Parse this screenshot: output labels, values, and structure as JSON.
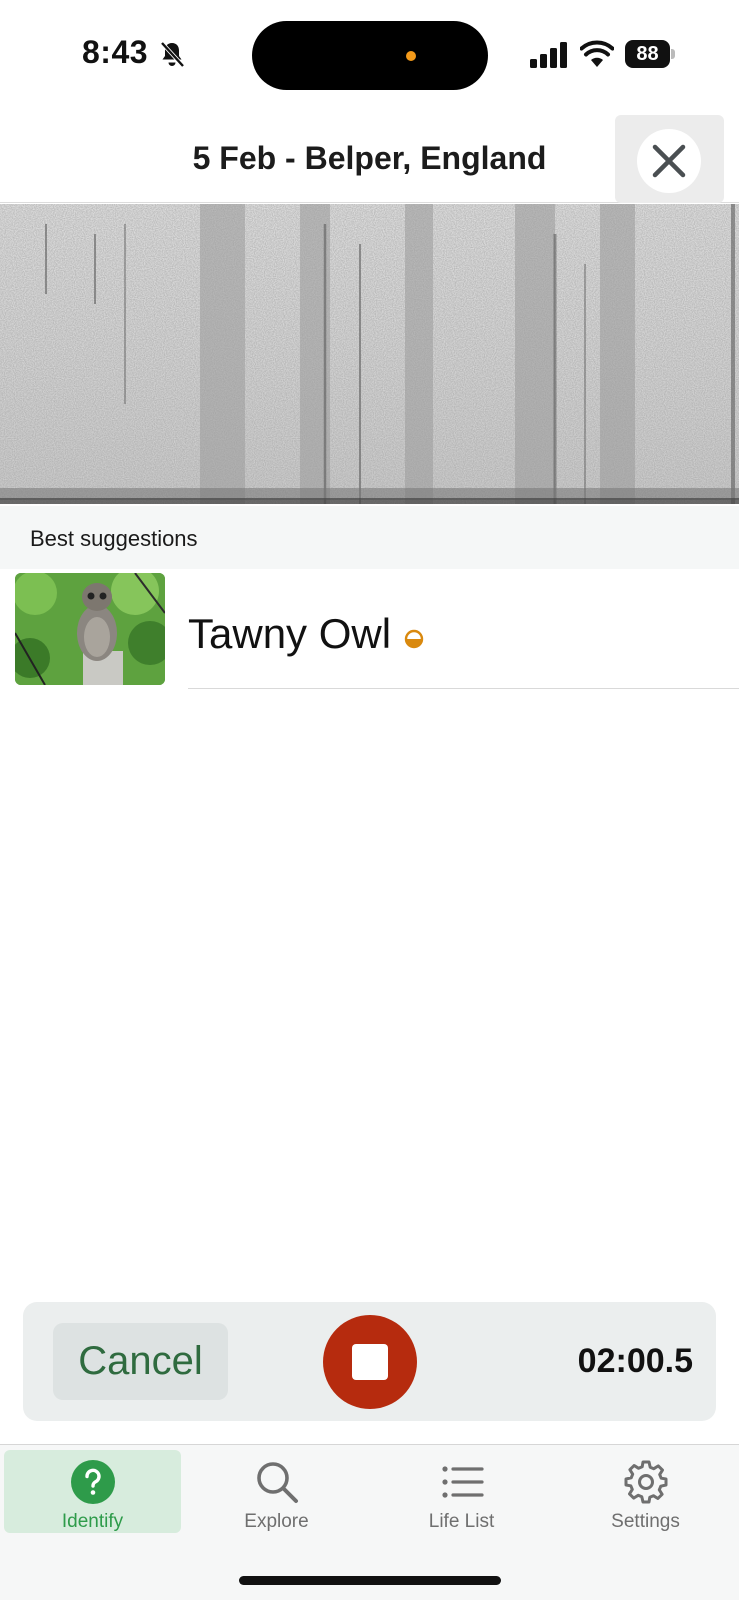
{
  "status_bar": {
    "time": "8:43",
    "battery": "88"
  },
  "header": {
    "title": "5 Feb - Belper, England"
  },
  "suggestions": {
    "section_label": "Best suggestions",
    "items": [
      {
        "name": "Tawny Owl",
        "image": "tawny-owl-photo",
        "confidence": "half"
      }
    ]
  },
  "recorder": {
    "cancel_label": "Cancel",
    "elapsed": "02:00.5"
  },
  "tabs": [
    {
      "label": "Identify",
      "icon": "question-icon",
      "active": true
    },
    {
      "label": "Explore",
      "icon": "search-icon",
      "active": false
    },
    {
      "label": "Life List",
      "icon": "list-icon",
      "active": false
    },
    {
      "label": "Settings",
      "icon": "gear-icon",
      "active": false
    }
  ],
  "colors": {
    "accent_green": "#2e9b4a",
    "stop_red": "#b62b0e",
    "confidence_orange": "#d9890f"
  }
}
